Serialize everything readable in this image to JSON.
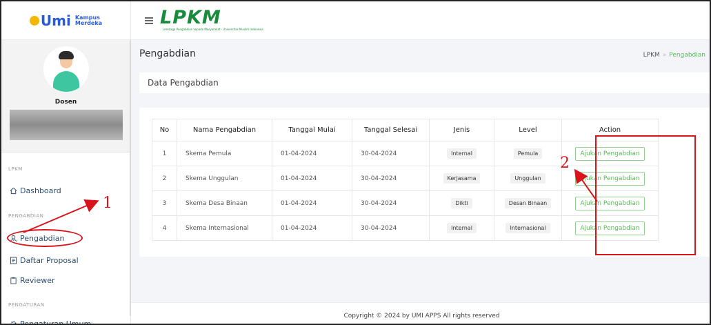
{
  "brand": {
    "main": "Umi",
    "sub": "Kampus\nMerdeka"
  },
  "topbar": {
    "logo": "LPKM",
    "logo_sub": "Lembaga Pengabdian kepada Masyarakat · Universitas Muslim Indonesia"
  },
  "profile": {
    "role": "Dosen"
  },
  "sidebar": {
    "sections": [
      "LPKM",
      "PENGABDIAN",
      "PENGATURAN"
    ],
    "items": [
      {
        "label": "Dashboard",
        "icon": "home-icon"
      },
      {
        "label": "Pengabdian",
        "icon": "hands-icon"
      },
      {
        "label": "Daftar Proposal",
        "icon": "document-icon"
      },
      {
        "label": "Reviewer",
        "icon": "clipboard-icon"
      },
      {
        "label": "Pengaturan Umum",
        "icon": "gear-icon"
      }
    ]
  },
  "page": {
    "title": "Pengabdian",
    "card_title": "Data Pengabdian"
  },
  "breadcrumb": {
    "root": "LPKM",
    "sep": "»",
    "current": "Pengabdian"
  },
  "table": {
    "headers": [
      "No",
      "Nama Pengabdian",
      "Tanggal Mulai",
      "Tanggal Selesai",
      "Jenis",
      "Level",
      "Action"
    ],
    "rows": [
      {
        "no": "1",
        "nama": "Skema Pemula",
        "mulai": "01-04-2024",
        "selesai": "30-04-2024",
        "jenis": "Internal",
        "level": "Pemula",
        "action": "Ajukan Pengabdian"
      },
      {
        "no": "2",
        "nama": "Skema Unggulan",
        "mulai": "01-04-2024",
        "selesai": "30-04-2024",
        "jenis": "Kerjasama",
        "level": "Unggulan",
        "action": "Ajukan Pengabdian"
      },
      {
        "no": "3",
        "nama": "Skema Desa Binaan",
        "mulai": "01-04-2024",
        "selesai": "30-04-2024",
        "jenis": "Dikti",
        "level": "Desan Binaan",
        "action": "Ajukan Pengabdian"
      },
      {
        "no": "4",
        "nama": "Skema Internasional",
        "mulai": "01-04-2024",
        "selesai": "30-04-2024",
        "jenis": "Internal",
        "level": "Internasional",
        "action": "Ajukan Pengabdian"
      }
    ]
  },
  "footer": {
    "text": "Copyright © 2024 by UMI APPS All rights reserved"
  },
  "annotations": {
    "label1": "1",
    "label2": "2",
    "color": "#d8141a"
  },
  "colors": {
    "accent": "#5cb85c",
    "logo_green": "#1a8a3d"
  }
}
